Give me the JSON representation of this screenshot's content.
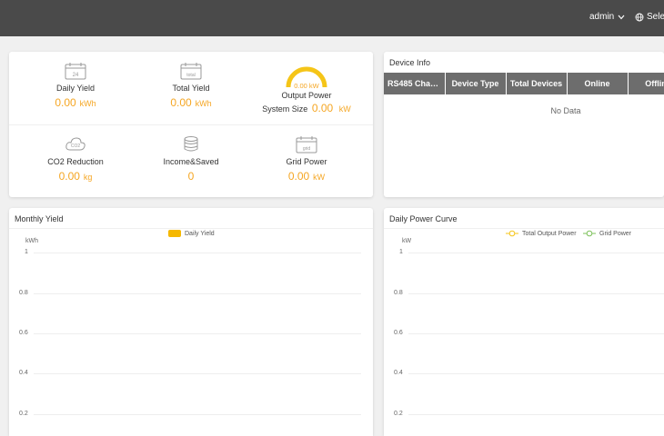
{
  "header": {
    "user": "admin",
    "language_label": "Selec"
  },
  "stats": {
    "daily_yield": {
      "label": "Daily Yield",
      "value": "0.00",
      "unit": "kWh",
      "icon_text": "24"
    },
    "total_yield": {
      "label": "Total Yield",
      "value": "0.00",
      "unit": "kWh",
      "icon_text": "total"
    },
    "output_power": {
      "gauge_value": "0.00 kW",
      "label": "Output Power",
      "system_size_label": "System Size",
      "system_size_value": "0.00",
      "system_size_unit": "kW"
    },
    "co2_reduction": {
      "label": "CO2 Reduction",
      "value": "0.00",
      "unit": "kg",
      "icon_text": "CO2"
    },
    "income_saved": {
      "label": "Income&Saved",
      "value": "0"
    },
    "grid_power": {
      "label": "Grid Power",
      "value": "0.00",
      "unit": "kW",
      "icon_text": "grid"
    }
  },
  "device_info": {
    "title": "Device Info",
    "columns": [
      "RS485 Chan...",
      "Device Type",
      "Total Devices",
      "Online",
      "Offlin"
    ],
    "empty_text": "No Data"
  },
  "monthly_yield": {
    "title": "Monthly Yield",
    "legend": "Daily Yield",
    "legend_color": "#f5b800",
    "unit": "kWh",
    "ticks": [
      "1",
      "0.8",
      "0.6",
      "0.4",
      "0.2"
    ]
  },
  "daily_power_curve": {
    "title": "Daily Power Curve",
    "legend": [
      {
        "name": "Total Output Power",
        "color": "#f5c518"
      },
      {
        "name": "Grid Power",
        "color": "#7cc05a"
      }
    ],
    "unit": "kW",
    "ticks": [
      "1",
      "0.8",
      "0.6",
      "0.4",
      "0.2"
    ]
  },
  "colors": {
    "accent": "#f5a623",
    "topbar": "#4a4a4a",
    "table_header": "#6d6d6d"
  }
}
